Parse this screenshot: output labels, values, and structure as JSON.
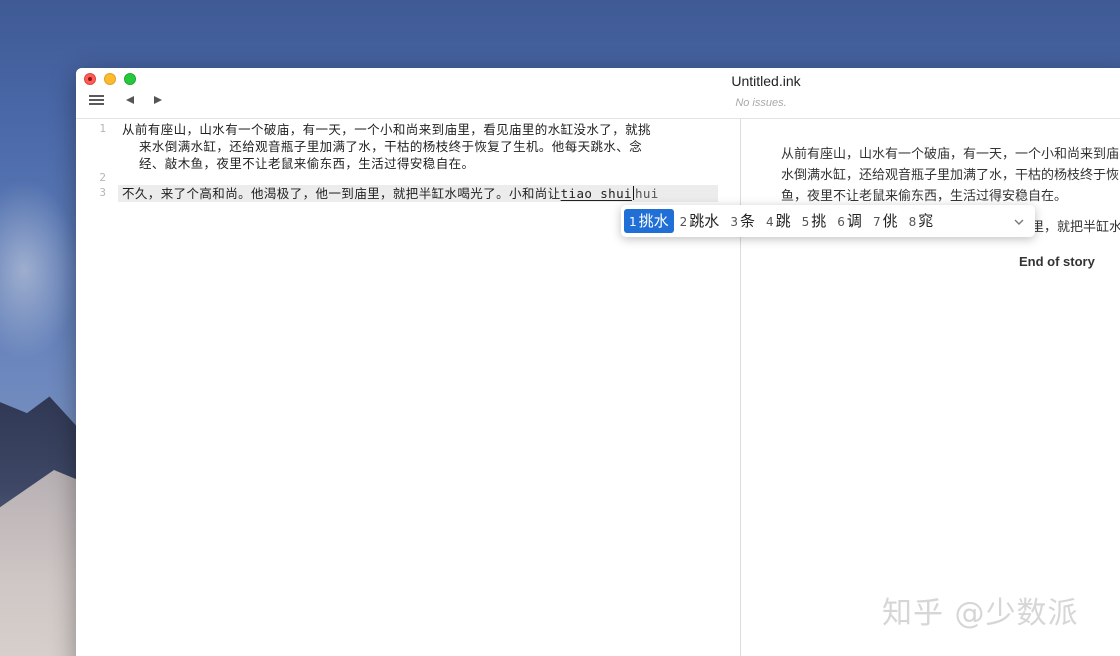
{
  "window": {
    "title": "Untitled.ink",
    "status": "No issues."
  },
  "icons": {
    "menu": "hamburger-menu-icon",
    "back": "triangle-left-icon",
    "forward": "triangle-right-icon",
    "expand": "chevron-down-icon"
  },
  "editor": {
    "lines": [
      {
        "number": "1",
        "text": "从前有座山，山水有一个破庙，有一天，一个小和尚来到庙里，看见庙里的水缸没水了，就挑",
        "continuation": [
          "来水倒满水缸，还给观音瓶子里加满了水，干枯的杨枝终于恢复了生机。他每天跳水、念",
          "经、敲木鱼，夜里不让老鼠来偷东西，生活过得安稳自在。"
        ]
      },
      {
        "number": "2",
        "text": ""
      },
      {
        "number": "3",
        "text": "不久，来了个高和尚。他渴极了，他一到庙里，就把半缸水喝光了。小和尚让",
        "composition": "tiao shui",
        "after": "hui"
      }
    ]
  },
  "ime": {
    "candidates": [
      {
        "num": "1",
        "word": "挑水",
        "selected": true
      },
      {
        "num": "2",
        "word": "跳水"
      },
      {
        "num": "3",
        "word": "条"
      },
      {
        "num": "4",
        "word": "跳"
      },
      {
        "num": "5",
        "word": "挑"
      },
      {
        "num": "6",
        "word": "调"
      },
      {
        "num": "7",
        "word": "佻"
      },
      {
        "num": "8",
        "word": "窕"
      }
    ]
  },
  "preview": {
    "para1": [
      "从前有座山，山水有一个破庙，有一天，一个小和尚来到庙",
      "水倒满水缸，还给观音瓶子里加满了水，干枯的杨枝终于恢",
      "鱼，夜里不让老鼠来偷东西，生活过得安稳自在。"
    ],
    "para2_visible": "里，就把半缸水",
    "end": "End of story"
  },
  "watermark": "知乎 @少数派"
}
